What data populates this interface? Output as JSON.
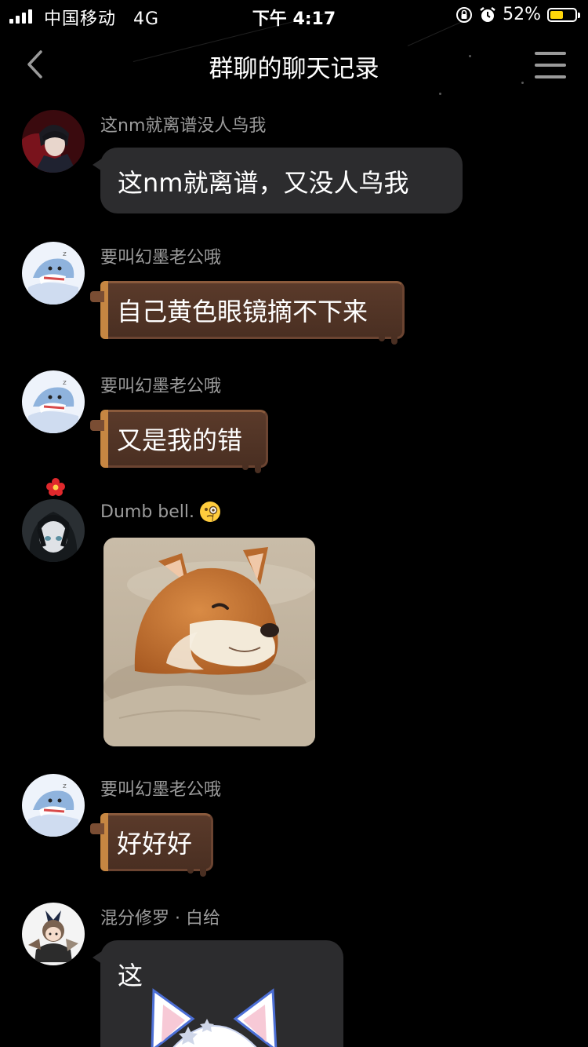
{
  "status_bar": {
    "carrier": "中国移动",
    "network": "4G",
    "time": "下午 4:17",
    "battery_percent_text": "52%",
    "battery_level": 0.52,
    "battery_color": "#ffd60a"
  },
  "nav": {
    "title": "群聊的聊天记录",
    "back_icon": "chevron-left-icon",
    "menu_icon": "hamburger-menu-icon"
  },
  "messages": [
    {
      "sender": "这nm就离谱没人鸟我",
      "type": "text-dark",
      "text": "这nm就离谱，又没人鸟我"
    },
    {
      "sender": "要叫幻墨老公哦",
      "type": "text-chocolate",
      "text": "自己黄色眼镜摘不下来"
    },
    {
      "sender": "要叫幻墨老公哦",
      "type": "text-chocolate",
      "text": "又是我的错"
    },
    {
      "sender": "Dumb bell.",
      "sender_emoji": "face-with-monocle-emoji",
      "type": "image",
      "image": "shiba-dog-in-sand-photo"
    },
    {
      "sender": "要叫幻墨老公哦",
      "type": "text-chocolate",
      "text": "好好好"
    },
    {
      "sender": "混分修罗 · 白给",
      "type": "text-dark-sticker",
      "text": "这",
      "sticker": "white-cat-ear-character-sticker"
    }
  ]
}
